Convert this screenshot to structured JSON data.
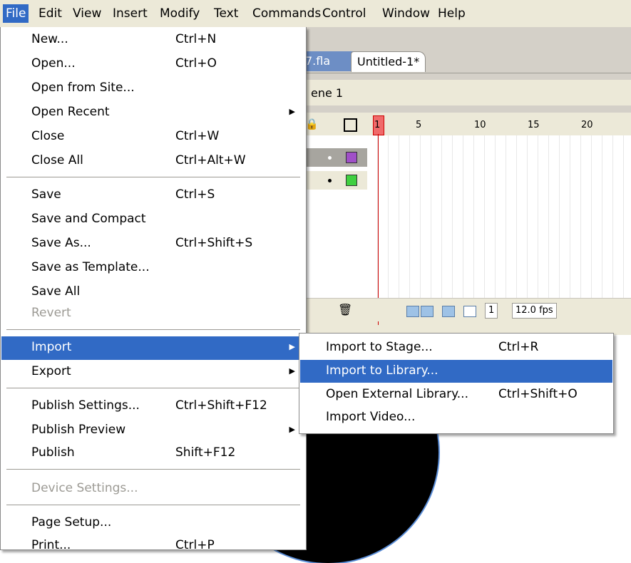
{
  "menubar": {
    "items": [
      "File",
      "Edit",
      "View",
      "Insert",
      "Modify",
      "Text",
      "Commands",
      "Control",
      "Window",
      "Help"
    ],
    "active": "File"
  },
  "document_tabs": [
    "7.fla",
    "Untitled-1*"
  ],
  "scene_label": "ene 1",
  "timeline": {
    "frame_ticks": [
      "1",
      "5",
      "10",
      "15",
      "20"
    ],
    "current_frame": "1",
    "fps": "12.0 fps",
    "layer_colors": [
      "#a050c8",
      "#40d040"
    ]
  },
  "file_menu": {
    "items": [
      {
        "label": "New...",
        "shortcut": "Ctrl+N"
      },
      {
        "label": "Open...",
        "shortcut": "Ctrl+O"
      },
      {
        "label": "Open from Site...",
        "shortcut": ""
      },
      {
        "label": "Open Recent",
        "shortcut": "",
        "submenu": true
      },
      {
        "label": "Close",
        "shortcut": "Ctrl+W"
      },
      {
        "label": "Close All",
        "shortcut": "Ctrl+Alt+W"
      },
      {
        "label": "Save",
        "shortcut": "Ctrl+S"
      },
      {
        "label": "Save and Compact",
        "shortcut": ""
      },
      {
        "label": "Save As...",
        "shortcut": "Ctrl+Shift+S"
      },
      {
        "label": "Save as Template...",
        "shortcut": ""
      },
      {
        "label": "Save All",
        "shortcut": ""
      },
      {
        "label": "Revert",
        "shortcut": "",
        "disabled": true
      },
      {
        "label": "Import",
        "shortcut": "",
        "submenu": true,
        "highlighted": true
      },
      {
        "label": "Export",
        "shortcut": "",
        "submenu": true
      },
      {
        "label": "Publish Settings...",
        "shortcut": "Ctrl+Shift+F12"
      },
      {
        "label": "Publish Preview",
        "shortcut": "",
        "submenu": true
      },
      {
        "label": "Publish",
        "shortcut": "Shift+F12"
      },
      {
        "label": "Device Settings...",
        "shortcut": "",
        "disabled": true
      },
      {
        "label": "Page Setup...",
        "shortcut": ""
      },
      {
        "label": "Print...",
        "shortcut": "Ctrl+P"
      }
    ]
  },
  "import_submenu": {
    "items": [
      {
        "label": "Import to Stage...",
        "shortcut": "Ctrl+R"
      },
      {
        "label": "Import to Library...",
        "shortcut": "",
        "highlighted": true
      },
      {
        "label": "Open External Library...",
        "shortcut": "Ctrl+Shift+O"
      },
      {
        "label": "Import Video...",
        "shortcut": ""
      }
    ]
  },
  "colors": {
    "menu_highlight": "#316ac5",
    "menubar_bg": "#ece9d8"
  }
}
